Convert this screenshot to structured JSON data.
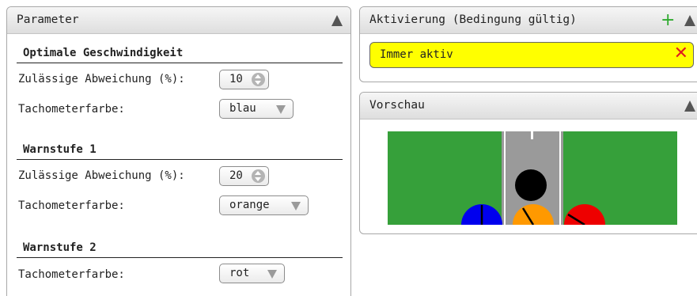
{
  "parameter_panel": {
    "title": "Parameter",
    "sections": [
      {
        "title": "Optimale Geschwindigkeit",
        "deviation_label": "Zulässige Abweichung (%):",
        "deviation_value": "10",
        "color_label": "Tachometerfarbe:",
        "color_value": "blau"
      },
      {
        "title": "Warnstufe 1",
        "deviation_label": "Zulässige Abweichung (%):",
        "deviation_value": "20",
        "color_label": "Tachometerfarbe:",
        "color_value": "orange"
      },
      {
        "title": "Warnstufe 2",
        "color_label": "Tachometerfarbe:",
        "color_value": "rot"
      }
    ]
  },
  "activation_panel": {
    "title": "Aktivierung (Bedingung gültig)",
    "condition_text": "Immer aktiv"
  },
  "preview_panel": {
    "title": "Vorschau"
  },
  "colors": {
    "condition_bg": "#ffff00",
    "add_icon": "#2eaa2e",
    "remove_icon": "#e01e1e",
    "preview_green": "#36a03a",
    "road_gray": "#9a9a9a",
    "gauge_blue": "#0000ee",
    "gauge_orange": "#ff9900",
    "gauge_red": "#ee0000"
  },
  "icons": {
    "collapse": "triangle-up-icon",
    "add": "plus-icon",
    "remove": "x-icon",
    "spinner": "spinner-icon",
    "dropdown": "chevron-down-icon"
  }
}
